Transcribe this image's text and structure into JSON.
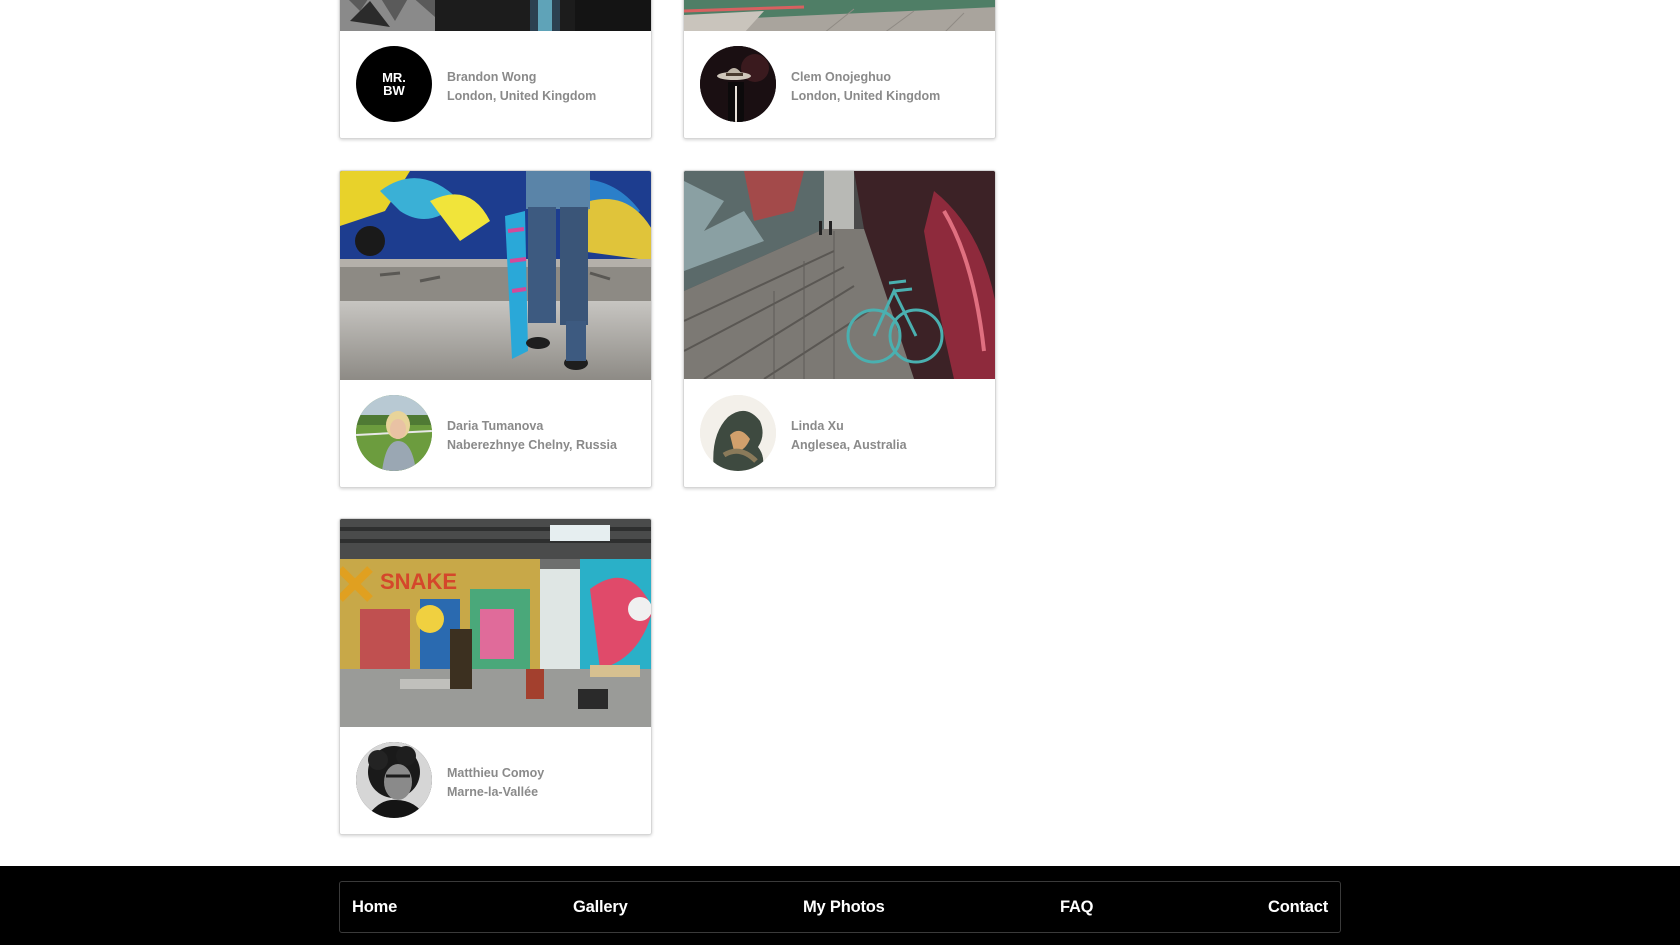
{
  "cards": [
    {
      "name": "Brandon Wong",
      "location": "London, United Kingdom",
      "avatar_text": "MR.\nBW"
    },
    {
      "name": "Clem Onojeghuo",
      "location": "London, United Kingdom"
    },
    {
      "name": "Daria Tumanova",
      "location": "Naberezhnye Chelny, Russia"
    },
    {
      "name": "Linda Xu",
      "location": "Anglesea, Australia"
    },
    {
      "name": "Matthieu Comoy",
      "location": "Marne-la-Vallée"
    }
  ],
  "nav": {
    "home": "Home",
    "gallery": "Gallery",
    "my_photos": "My Photos",
    "faq": "FAQ",
    "contact": "Contact"
  }
}
